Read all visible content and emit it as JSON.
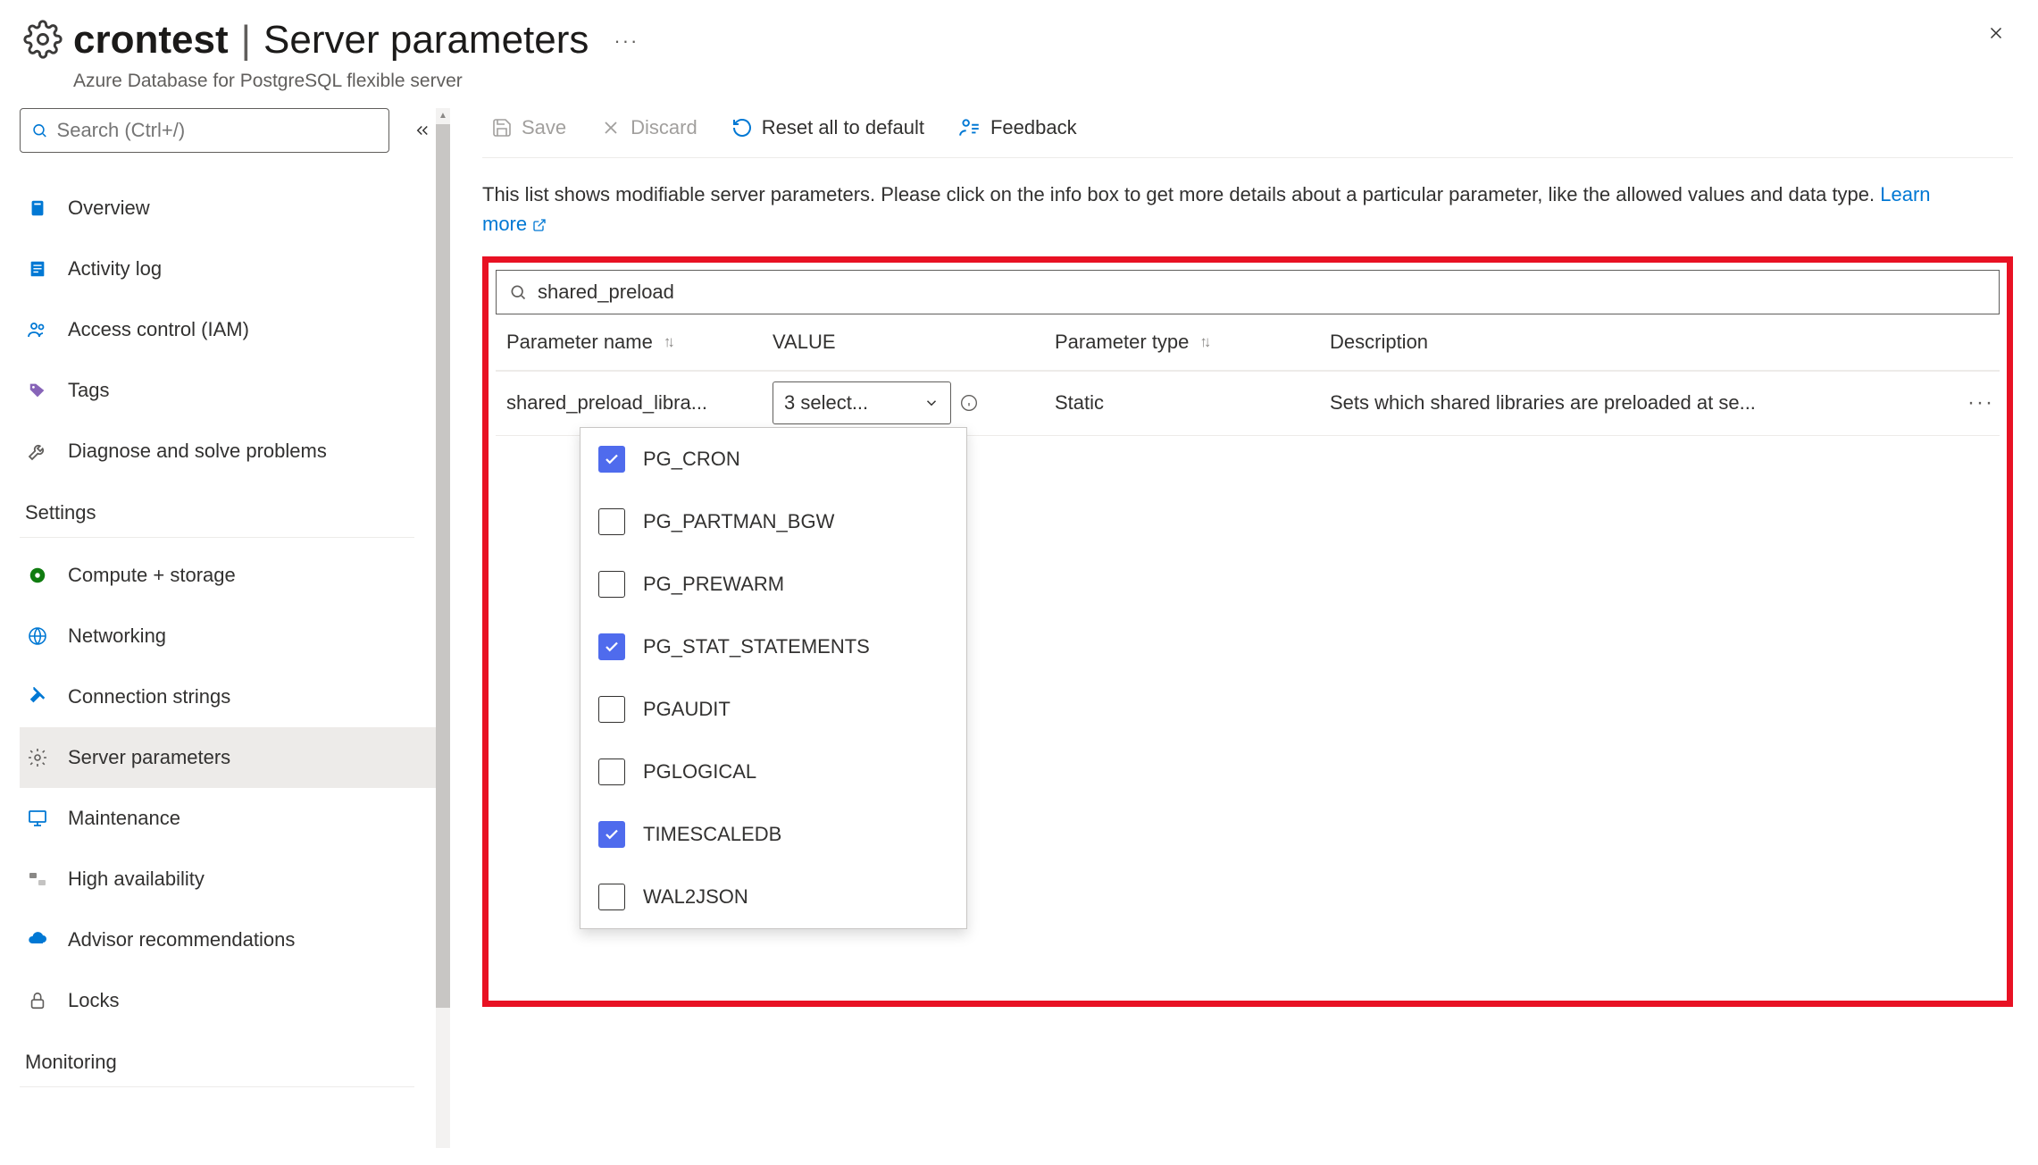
{
  "header": {
    "resource_name": "crontest",
    "page_title": "Server parameters",
    "subtitle": "Azure Database for PostgreSQL flexible server"
  },
  "sidebar": {
    "search_placeholder": "Search (Ctrl+/)",
    "top_items": [
      {
        "label": "Overview",
        "icon": "server",
        "color": "#0078d4"
      },
      {
        "label": "Activity log",
        "icon": "log",
        "color": "#0078d4"
      },
      {
        "label": "Access control (IAM)",
        "icon": "people",
        "color": "#0078d4"
      },
      {
        "label": "Tags",
        "icon": "tag",
        "color": "#8764b8"
      },
      {
        "label": "Diagnose and solve problems",
        "icon": "wrench",
        "color": "#605e5c"
      }
    ],
    "sections": [
      {
        "heading": "Settings",
        "items": [
          {
            "label": "Compute + storage",
            "icon": "disc",
            "color": "#107c10"
          },
          {
            "label": "Networking",
            "icon": "globe",
            "color": "#0078d4"
          },
          {
            "label": "Connection strings",
            "icon": "plug",
            "color": "#0078d4"
          },
          {
            "label": "Server parameters",
            "icon": "gear",
            "color": "#605e5c",
            "active": true
          },
          {
            "label": "Maintenance",
            "icon": "monitor",
            "color": "#0078d4"
          },
          {
            "label": "High availability",
            "icon": "ha",
            "color": "#8a8886"
          },
          {
            "label": "Advisor recommendations",
            "icon": "cloud",
            "color": "#0078d4"
          },
          {
            "label": "Locks",
            "icon": "lock",
            "color": "#605e5c"
          }
        ]
      },
      {
        "heading": "Monitoring",
        "items": []
      }
    ]
  },
  "toolbar": {
    "save": "Save",
    "discard": "Discard",
    "reset": "Reset all to default",
    "feedback": "Feedback"
  },
  "intro": {
    "text": "This list shows modifiable server parameters. Please click on the info box to get more details about a particular parameter, like the allowed values and data type. ",
    "learn_more": "Learn more"
  },
  "filter": {
    "value": "shared_preload"
  },
  "columns": {
    "name": "Parameter name",
    "value": "VALUE",
    "type": "Parameter type",
    "desc": "Description"
  },
  "row": {
    "name": "shared_preload_libra...",
    "selected_text": "3 select...",
    "type": "Static",
    "desc": "Sets which shared libraries are preloaded at se..."
  },
  "dropdown": {
    "options": [
      {
        "label": "PG_CRON",
        "checked": true
      },
      {
        "label": "PG_PARTMAN_BGW",
        "checked": false
      },
      {
        "label": "PG_PREWARM",
        "checked": false
      },
      {
        "label": "PG_STAT_STATEMENTS",
        "checked": true
      },
      {
        "label": "PGAUDIT",
        "checked": false
      },
      {
        "label": "PGLOGICAL",
        "checked": false
      },
      {
        "label": "TIMESCALEDB",
        "checked": true
      },
      {
        "label": "WAL2JSON",
        "checked": false
      }
    ]
  }
}
